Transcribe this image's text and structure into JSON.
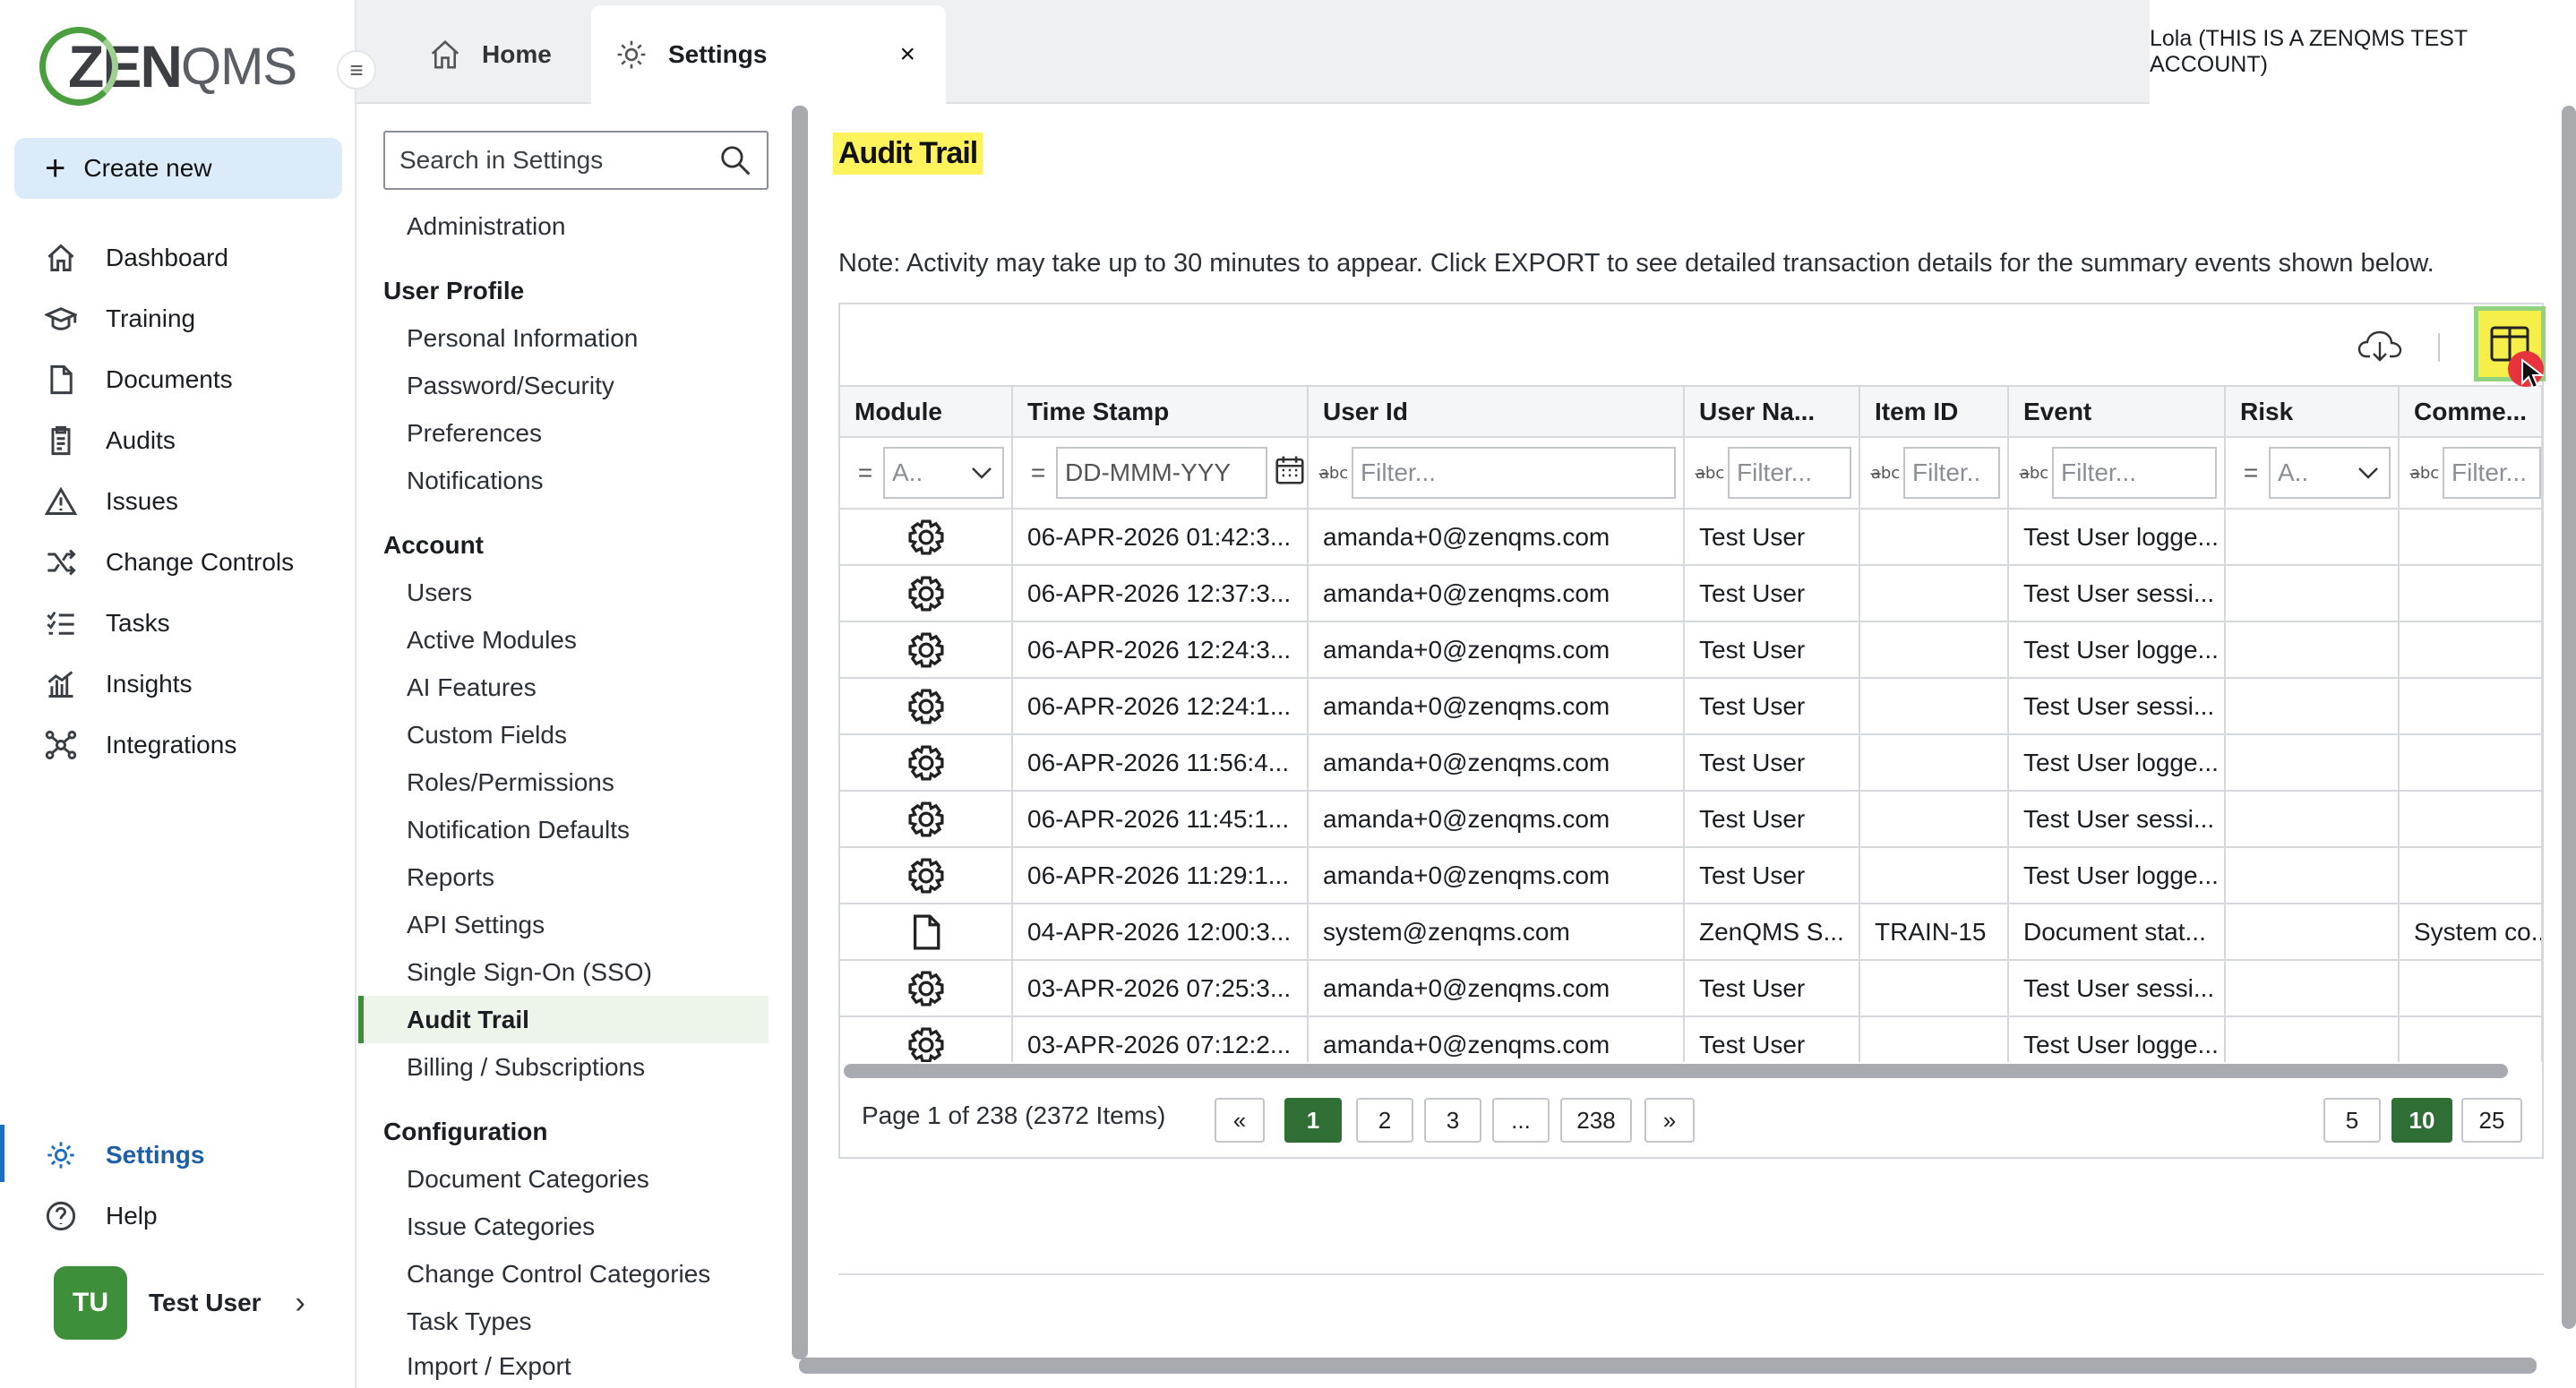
{
  "brand": {
    "logo_a": "ZEN",
    "logo_b": "QMS"
  },
  "nav": {
    "create_new": "Create new",
    "items": [
      {
        "label": "Dashboard",
        "icon": "home-icon"
      },
      {
        "label": "Training",
        "icon": "graduation-cap-icon"
      },
      {
        "label": "Documents",
        "icon": "document-icon"
      },
      {
        "label": "Audits",
        "icon": "clipboard-icon"
      },
      {
        "label": "Issues",
        "icon": "warning-icon"
      },
      {
        "label": "Change Controls",
        "icon": "shuffle-icon"
      },
      {
        "label": "Tasks",
        "icon": "checklist-icon"
      },
      {
        "label": "Insights",
        "icon": "bar-chart-icon"
      },
      {
        "label": "Integrations",
        "icon": "network-icon"
      }
    ],
    "settings": "Settings",
    "help": "Help",
    "user_initials": "TU",
    "user_name": "Test User"
  },
  "tabs": {
    "home": "Home",
    "settings": "Settings",
    "close": "×"
  },
  "account_label": "Lola (THIS IS A ZENQMS TEST ACCOUNT)",
  "settings_menu": {
    "search_placeholder": "Search in Settings",
    "admin": "Administration",
    "user_profile": {
      "heading": "User Profile",
      "items": [
        "Personal Information",
        "Password/Security",
        "Preferences",
        "Notifications"
      ]
    },
    "account": {
      "heading": "Account",
      "items": [
        "Users",
        "Active Modules",
        "AI Features",
        "Custom Fields",
        "Roles/Permissions",
        "Notification Defaults",
        "Reports",
        "API Settings",
        "Single Sign-On (SSO)",
        "Audit Trail",
        "Billing / Subscriptions"
      ]
    },
    "configuration": {
      "heading": "Configuration",
      "items": [
        "Document Categories",
        "Issue Categories",
        "Change Control Categories",
        "Task Types",
        "Import / Export"
      ]
    },
    "selected": "Audit Trail"
  },
  "page": {
    "title": "Audit Trail",
    "note": "Note: Activity may take up to 30 minutes to appear. Click EXPORT to see detailed transaction details for the summary events shown below."
  },
  "grid": {
    "columns": [
      "Module",
      "Time Stamp",
      "User Id",
      "User Na...",
      "Item ID",
      "Event",
      "Risk",
      "Comme..."
    ],
    "filters": {
      "module": "A..",
      "timestamp": "DD-MMM-YYY",
      "userid": "Filter...",
      "username": "Filter...",
      "itemid": "Filter..",
      "event": "Filter...",
      "risk": "A..",
      "comment": "Filter..."
    },
    "rows": [
      {
        "module": "gear-icon",
        "ts": "06-APR-2026 01:42:3...",
        "uid": "amanda+0@zenqms.com",
        "uname": "Test User",
        "item": "",
        "event": "Test User logge...",
        "risk": "",
        "comment": ""
      },
      {
        "module": "gear-icon",
        "ts": "06-APR-2026 12:37:3...",
        "uid": "amanda+0@zenqms.com",
        "uname": "Test User",
        "item": "",
        "event": "Test User sessi...",
        "risk": "",
        "comment": ""
      },
      {
        "module": "gear-icon",
        "ts": "06-APR-2026 12:24:3...",
        "uid": "amanda+0@zenqms.com",
        "uname": "Test User",
        "item": "",
        "event": "Test User logge...",
        "risk": "",
        "comment": ""
      },
      {
        "module": "gear-icon",
        "ts": "06-APR-2026 12:24:1...",
        "uid": "amanda+0@zenqms.com",
        "uname": "Test User",
        "item": "",
        "event": "Test User sessi...",
        "risk": "",
        "comment": ""
      },
      {
        "module": "gear-icon",
        "ts": "06-APR-2026 11:56:4...",
        "uid": "amanda+0@zenqms.com",
        "uname": "Test User",
        "item": "",
        "event": "Test User logge...",
        "risk": "",
        "comment": ""
      },
      {
        "module": "gear-icon",
        "ts": "06-APR-2026 11:45:1...",
        "uid": "amanda+0@zenqms.com",
        "uname": "Test User",
        "item": "",
        "event": "Test User sessi...",
        "risk": "",
        "comment": ""
      },
      {
        "module": "gear-icon",
        "ts": "06-APR-2026 11:29:1...",
        "uid": "amanda+0@zenqms.com",
        "uname": "Test User",
        "item": "",
        "event": "Test User logge...",
        "risk": "",
        "comment": ""
      },
      {
        "module": "document-icon",
        "ts": "04-APR-2026 12:00:3...",
        "uid": "system@zenqms.com",
        "uname": "ZenQMS S...",
        "item": "TRAIN-15",
        "event": "Document stat...",
        "risk": "",
        "comment": "System co..."
      },
      {
        "module": "gear-icon",
        "ts": "03-APR-2026 07:25:3...",
        "uid": "amanda+0@zenqms.com",
        "uname": "Test User",
        "item": "",
        "event": "Test User sessi...",
        "risk": "",
        "comment": ""
      },
      {
        "module": "gear-icon",
        "ts": "03-APR-2026 07:12:2...",
        "uid": "amanda+0@zenqms.com",
        "uname": "Test User",
        "item": "",
        "event": "Test User logge...",
        "risk": "",
        "comment": ""
      }
    ],
    "pager": {
      "info": "Page 1 of 238 (2372 Items)",
      "first": "«",
      "pages": [
        "1",
        "2",
        "3",
        "...",
        "238"
      ],
      "last": "»",
      "current": "1",
      "sizes": [
        "5",
        "10",
        "25"
      ],
      "current_size": "10"
    }
  },
  "colors": {
    "accent_green": "#2f6e35",
    "highlight_yellow": "#fff35c",
    "nav_selected_bg": "#dcebf9",
    "link_blue": "#1d6fc1"
  }
}
